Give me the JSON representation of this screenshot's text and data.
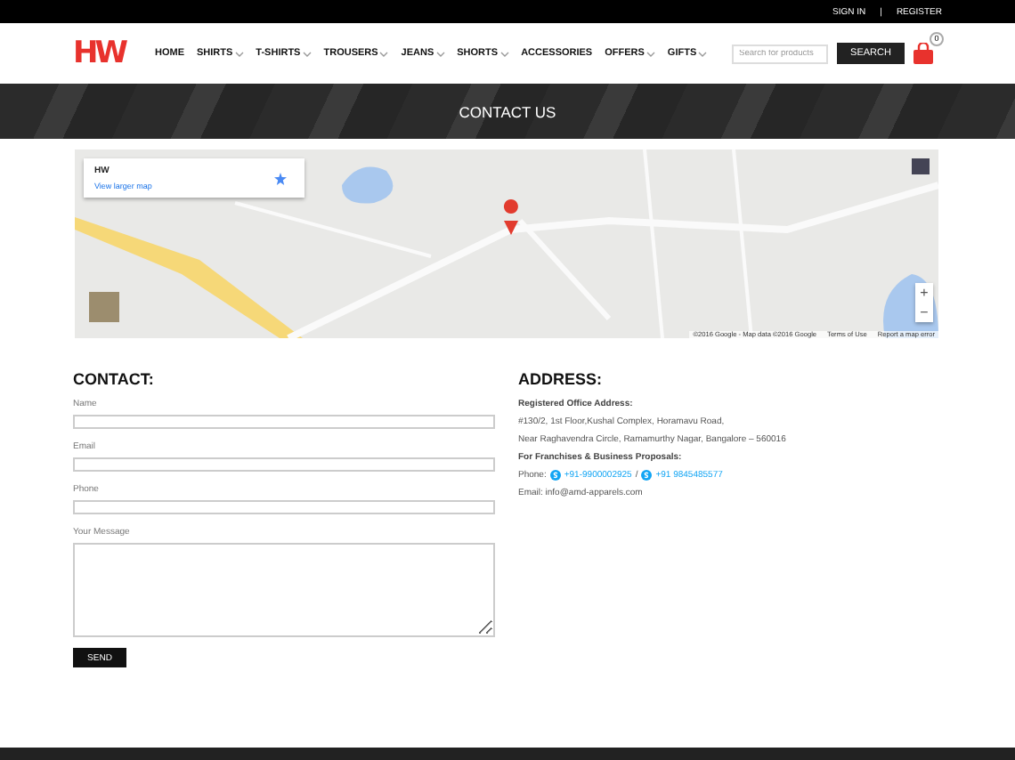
{
  "top_bar": {
    "links": [
      "SIGN IN",
      "REGISTER"
    ],
    "separator": "|"
  },
  "header": {
    "logo": "HW",
    "nav": [
      {
        "label": "HOME",
        "dropdown": false
      },
      {
        "label": "SHIRTS",
        "dropdown": true
      },
      {
        "label": "T-SHIRTS",
        "dropdown": true
      },
      {
        "label": "TROUSERS",
        "dropdown": true
      },
      {
        "label": "JEANS",
        "dropdown": true
      },
      {
        "label": "SHORTS",
        "dropdown": true
      },
      {
        "label": "ACCESSORIES",
        "dropdown": false
      },
      {
        "label": "OFFERS",
        "dropdown": true
      },
      {
        "label": "GIFTS",
        "dropdown": true
      }
    ],
    "search": {
      "placeholder": "Search for products",
      "button": "SEARCH"
    },
    "cart_count": "0"
  },
  "banner": {
    "title": "CONTACT US"
  },
  "map": {
    "kind": "picture",
    "info_card": {
      "title": "HW",
      "link": "View larger map"
    },
    "zoom_in": "+",
    "zoom_out": "−",
    "attribution": [
      "©2016 Google - Map data ©2016 Google",
      "Terms of Use",
      "Report a map error"
    ]
  },
  "contact": {
    "title": "CONTACT:",
    "fields": [
      {
        "label": "Name",
        "kind": "input"
      },
      {
        "label": "Email",
        "kind": "input"
      },
      {
        "label": "Phone",
        "kind": "input"
      },
      {
        "label": "Your Message",
        "kind": "textarea"
      }
    ],
    "button": "SEND"
  },
  "address": {
    "title": "ADDRESS:",
    "office_heading": "Registered Office Address:",
    "lines": [
      "#130/2, 1st Floor,Kushal Complex, Horamavu Road,",
      "Near Raghavendra Circle, Ramamurthy Nagar, Bangalore – 560016"
    ],
    "proposals_heading": "For Franchises & Business Proposals:",
    "phone_label": "Phone:",
    "phones": [
      "+91-9900002925",
      "+91 9845485577"
    ],
    "phone_separator": "/",
    "email": "Email: info@amd-apparels.com"
  }
}
